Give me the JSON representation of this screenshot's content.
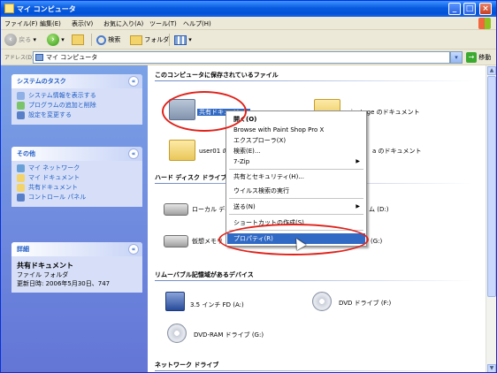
{
  "window": {
    "title": "マイ コンピュータ"
  },
  "menu": [
    "ファイル(F)",
    "編集(E)",
    "表示(V)",
    "お気に入り(A)",
    "ツール(T)",
    "ヘルプ(H)"
  ],
  "toolbar": {
    "back": "戻る",
    "search": "検索",
    "folders": "フォルダ"
  },
  "address": {
    "label": "アドレス(D)",
    "value": "マイ コンピュータ",
    "go": "移動"
  },
  "sidebar": {
    "system_tasks": {
      "title": "システムのタスク",
      "links": [
        "システム情報を表示する",
        "プログラムの追加と削除",
        "設定を変更する"
      ]
    },
    "other_places": {
      "title": "その他",
      "links": [
        "マイ ネットワーク",
        "マイ ドキュメント",
        "共有ドキュメント",
        "コントロール パネル"
      ]
    },
    "details": {
      "title": "詳細",
      "name": "共有ドキュメント",
      "type": "ファイル フォルダ",
      "modified": "更新日時: 2006年5月30日、747"
    }
  },
  "content": {
    "groups": {
      "stored_files": "このコンピュータに保存されているファイル",
      "hard_drives": "ハード ディスク ドライブ",
      "removable": "リムーバブル記憶域があるデバイス",
      "network": "ネットワーク ドライブ"
    },
    "items": {
      "shared_docs": "共有ドキュメント",
      "user_docs_a": "_ninetage のドキュメント",
      "user01_docs": "user01 のドキュ",
      "user_docs_b": "a のドキュメント",
      "local_disk": "ローカル ディスク",
      "local_disk_d": "ム (D:)",
      "virtual_mem": "仮想メモリ ドライブ",
      "virtual_mem_suffix": "(G:)",
      "floppy": "3.5 インチ FD (A:)",
      "dvd": "DVD ドライブ (F:)",
      "dvd_ram": "DVD-RAM ドライブ (G:)"
    }
  },
  "context_menu": [
    {
      "label": "開く(O)",
      "bold": true
    },
    {
      "label": "Browse with Paint Shop Pro X"
    },
    {
      "label": "エクスプローラ(X)"
    },
    {
      "label": "検索(E)..."
    },
    {
      "label": "7-Zip",
      "submenu": true
    },
    {
      "label": "共有とセキュリティ(H)..."
    },
    {
      "label": "ウイルス検索の実行"
    },
    {
      "label": "送る(N)",
      "submenu": true
    },
    {
      "label": "ショートカットの作成(S)"
    },
    {
      "label": "プロパティ(R)",
      "highlighted": true
    }
  ],
  "colors": {
    "title_blue": "#0a5ae0",
    "highlight": "#316ac5",
    "annotation_red": "#e0221a"
  }
}
